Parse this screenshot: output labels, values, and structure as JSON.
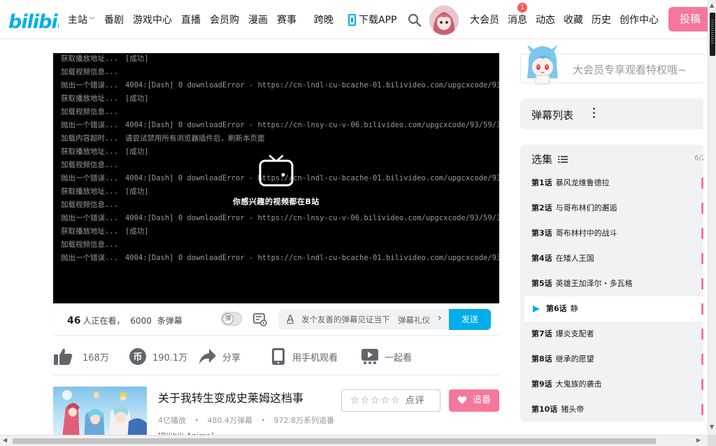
{
  "colors": {
    "brand_blue": "#00aeec",
    "brand_pink": "#f4779c",
    "notice_red": "#fa5a57"
  },
  "header": {
    "logo_alt": "bilibili",
    "nav": [
      {
        "label": "主站",
        "icon": "chevron-down-icon"
      },
      {
        "label": "番剧"
      },
      {
        "label": "游戏中心"
      },
      {
        "label": "直播"
      },
      {
        "label": "会员购"
      },
      {
        "label": "漫画"
      },
      {
        "label": "赛事"
      },
      {
        "label": "跨晚"
      }
    ],
    "download": "下载APP",
    "right_nav": [
      "大会员",
      "消息",
      "动态",
      "收藏",
      "历史",
      "创作中心"
    ],
    "message_badge": "1",
    "upload": "投稿"
  },
  "player": {
    "log_lines": [
      {
        "a": "获取播放地址...",
        "b": "[成功]"
      },
      {
        "a": "加载视频信息..."
      },
      {
        "a": "抛出一个错误...",
        "b": "4004:[Dash] 0 downloadError - https://cn-lndl-cu-bcache-01.bilivideo.com/upgcxcode/93/59/304"
      },
      {
        "a": "获取播放地址...",
        "b": "[成功]"
      },
      {
        "a": "加载视频信息..."
      },
      {
        "a": "抛出一个错误...",
        "b": "4004:[Dash] 0 downloadError - https://cn-lnsy-cu-v-06.bilivideo.com/upgcxcode/93/59/3041"
      },
      {
        "a": "加载内容超时...",
        "b": "请尝试禁用所有浏览器插件后，刷新本页面"
      },
      {
        "a": "获取播放地址...",
        "b": "[成功]"
      },
      {
        "a": "加载视频信息..."
      },
      {
        "a": "抛出一个错误...",
        "b": "4004:[Dash] 0 downloadError - https://cn-lndl-cu-bcache-01.bilivideo.com/upgcxcode/93/59/304"
      },
      {
        "a": "获取播放地址...",
        "b": "[成功]"
      },
      {
        "a": "加载视频信息..."
      },
      {
        "a": "抛出一个错误...",
        "b": "4004:[Dash] 0 downloadError - https://cn-lnsy-cu-v-06.bilivideo.com/upgcxcode/93/59/3041"
      },
      {
        "a": "获取播放地址...",
        "b": "[成功]"
      },
      {
        "a": "加载视频信息..."
      },
      {
        "a": "抛出一个错误...",
        "b": "4004:[Dash] 0 downloadError - https://cn-lndl-cu-bcache-01.bilivideo.com/upgcxcode/93/59/304"
      }
    ],
    "slogan": "你感兴趣的视频都在B站"
  },
  "danmaku_bar": {
    "viewers_count": "46",
    "viewers_text": "人正在看，",
    "danmaku_count": "6000",
    "danmaku_text": "条弹幕",
    "toggle_label": "弹",
    "input_placeholder": "发个友善的弹幕见证当下",
    "etiquette": "弹幕礼仪",
    "send": "发送"
  },
  "toolbar": {
    "like": "168万",
    "coin": "190.1万",
    "share": "分享",
    "mobile": "用手机观看",
    "watch_together": "一起看"
  },
  "media": {
    "title": "关于我转生变成史莱姆这档事",
    "plays": "4亿播放",
    "danmaku": "480.4万弹幕",
    "follows": "972.8万系列追番",
    "subline": "[Bilibili Anime]",
    "rate_label": "点评",
    "follow_label": "追番"
  },
  "sidebar": {
    "vip_text": "大会员专享观看特权哦~",
    "danmaku_list": "弹幕列表",
    "episodes_title": "选集",
    "page_info": "6/2",
    "episodes": [
      {
        "num": "第1话",
        "title": "暴风龙维鲁德拉"
      },
      {
        "num": "第2话",
        "title": "与哥布林们的邂逅"
      },
      {
        "num": "第3话",
        "title": "哥布林村中的战斗"
      },
      {
        "num": "第4话",
        "title": "在矮人王国"
      },
      {
        "num": "第5话",
        "title": "英雄王加泽尔・多瓦格"
      },
      {
        "num": "第6话",
        "title": "静"
      },
      {
        "num": "第7话",
        "title": "爆炎支配者"
      },
      {
        "num": "第8话",
        "title": "继承的愿望"
      },
      {
        "num": "第9话",
        "title": "大鬼族的袭击"
      },
      {
        "num": "第10话",
        "title": "猪头帝"
      }
    ],
    "active_episode": 6
  }
}
